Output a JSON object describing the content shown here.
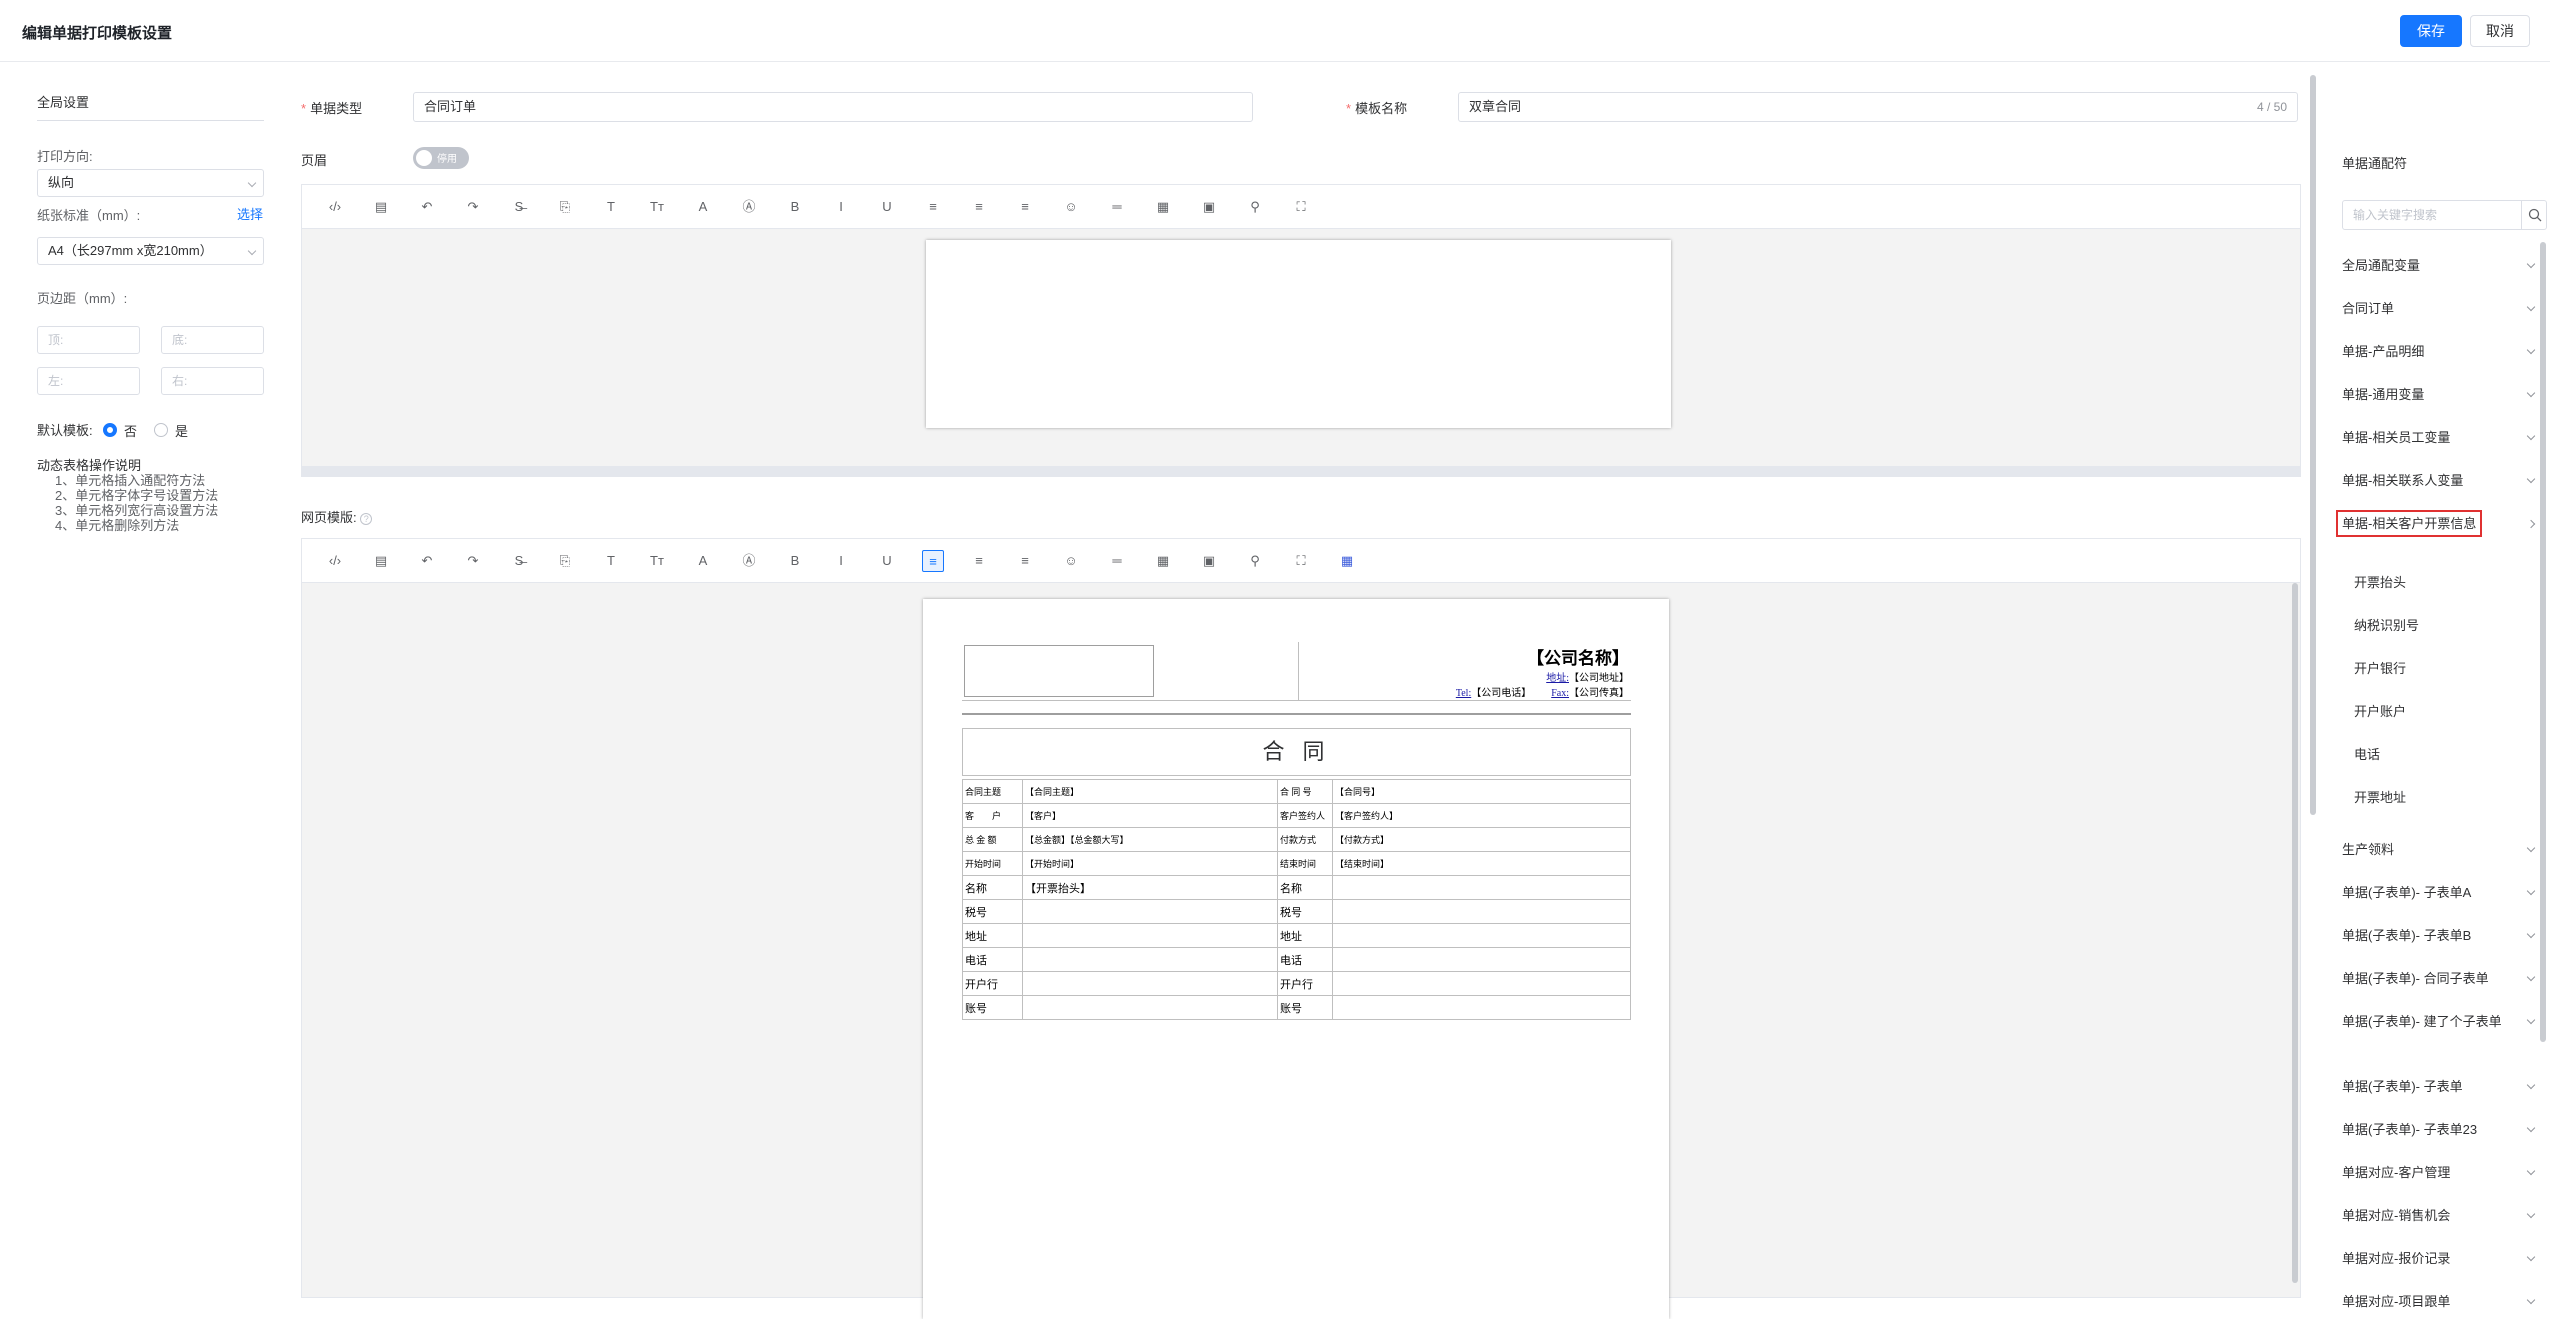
{
  "header": {
    "title": "编辑单据打印模板设置",
    "save": "保存",
    "cancel": "取消"
  },
  "left": {
    "section_title": "全局设置",
    "print_dir_label": "打印方向:",
    "print_dir_value": "纵向",
    "paper_label": "纸张标准（mm）:",
    "paper_select": "选择",
    "paper_value": "A4（长297mm x宽210mm）",
    "margin_label": "页边距（mm）:",
    "margin_top": "顶:",
    "margin_bottom": "底:",
    "margin_left": "左:",
    "margin_right": "右:",
    "default_label": "默认模板:",
    "default_no": "否",
    "default_yes": "是",
    "notes_title": "动态表格操作说明",
    "notes": [
      "1、单元格插入通配符方法",
      "2、单元格字体字号设置方法",
      "3、单元格列宽行高设置方法",
      "4、单元格删除列方法"
    ]
  },
  "main": {
    "doc_type_label": "单据类型",
    "doc_type_value": "合同订单",
    "tpl_name_label": "模板名称",
    "tpl_name_value": "双章合同",
    "tpl_name_count": "4 / 50",
    "header_label": "页眉",
    "header_toggle": "停用",
    "body_label": "网页模版:"
  },
  "toolbar_icons": [
    "code-icon",
    "template-icon",
    "undo-icon",
    "redo-icon",
    "strikethrough-icon",
    "paste-icon",
    "font-icon",
    "font-size-icon",
    "font-color-icon",
    "background-color-icon",
    "bold-icon",
    "italic-icon",
    "underline-icon",
    "align-left-icon",
    "align-center-icon",
    "align-right-icon",
    "emoji-icon",
    "horizontal-rule-icon",
    "table-icon",
    "image-icon",
    "attachment-icon",
    "fullscreen-icon"
  ],
  "toolbar_glyphs": [
    "‹/›",
    "▤",
    "↶",
    "↷",
    "S̶",
    "⎘",
    "T",
    "Tт",
    "A",
    "Ⓐ",
    "B",
    "I",
    "U",
    "≡",
    "≡",
    "≡",
    "☺",
    "═",
    "▦",
    "▣",
    "⚲",
    "⛶"
  ],
  "doc": {
    "company": "【公司名称】",
    "addr_lbl": "地址:",
    "addr": "【公司地址】",
    "tel_lbl": "Tel:",
    "tel": "【公司电话】",
    "fax_lbl": "Fax:",
    "fax": "【公司传真】",
    "title": "合 同",
    "rows": [
      [
        "合同主题",
        "【合同主题】",
        "合 同 号",
        "【合同号】"
      ],
      [
        "客　　户",
        "【客户】",
        "客户签约人",
        "【客户签约人】"
      ],
      [
        "总 金 额",
        "【总金额】【总金额大写】",
        "付款方式",
        "【付款方式】"
      ],
      [
        "开始时间",
        "【开始时间】",
        "结束时间",
        "【结束时间】"
      ],
      [
        "名称",
        "【开票抬头】",
        "名称",
        ""
      ],
      [
        "税号",
        "",
        "税号",
        ""
      ],
      [
        "地址",
        "",
        "地址",
        ""
      ],
      [
        "电话",
        "",
        "电话",
        ""
      ],
      [
        "开户行",
        "",
        "开户行",
        ""
      ],
      [
        "账号",
        "",
        "账号",
        ""
      ]
    ]
  },
  "right": {
    "title": "单据通配符",
    "search_placeholder": "输入关键字搜索",
    "groups": [
      "全局通配变量",
      "合同订单",
      "单据-产品明细",
      "单据-通用变量",
      "单据-相关员工变量",
      "单据-相关联系人变量",
      "单据-相关客户开票信息"
    ],
    "sub_items": [
      "开票抬头",
      "纳税识别号",
      "开户银行",
      "开户账户",
      "电话",
      "开票地址"
    ],
    "groups2": [
      "生产领料",
      "单据(子表单)- 子表单A",
      "单据(子表单)- 子表单B",
      "单据(子表单)- 合同子表单",
      "单据(子表单)- 建了个子表单",
      "单据(子表单)- 子表单",
      "单据(子表单)- 子表单23",
      "单据对应-客户管理",
      "单据对应-销售机会",
      "单据对应-报价记录",
      "单据对应-项目跟单"
    ]
  },
  "colors": {
    "primary": "#1677ff",
    "highlight": "#e03131",
    "required": "#f56c6c"
  }
}
